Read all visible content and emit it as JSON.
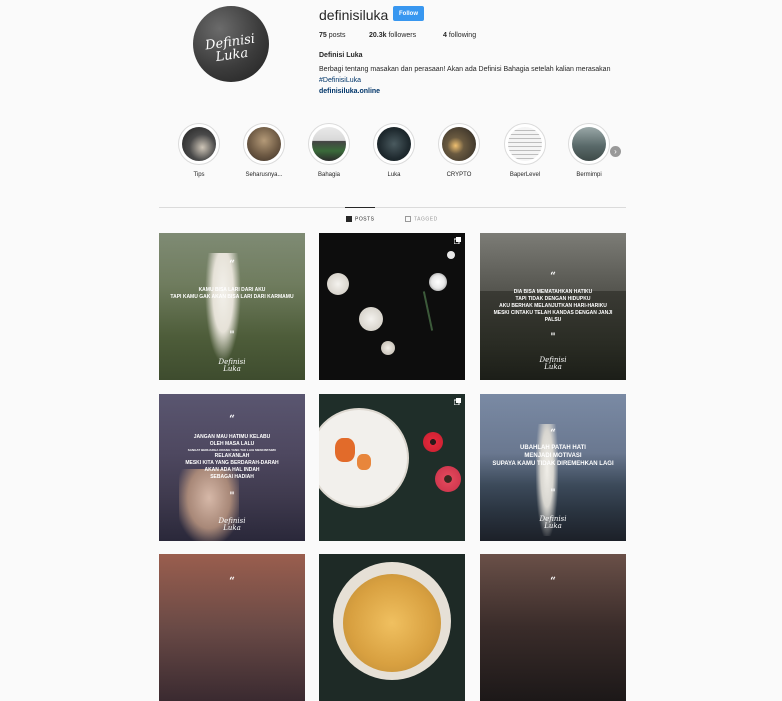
{
  "profile": {
    "username": "definisiluka",
    "follow_label": "Follow",
    "avatar_logo_line1": "Definisi",
    "avatar_logo_line2": "Luka",
    "posts_count": "75",
    "posts_label": "posts",
    "followers_count": "20.3k",
    "followers_label": "followers",
    "following_count": "4",
    "following_label": "following",
    "full_name": "Definisi Luka",
    "bio": "Berbagi tentang masakan dan perasaan! Akan ada Definisi Bahagia setelah kalian merasakan",
    "bio_hashtag": "#DefinisiLuka",
    "website": "definisiluka.online"
  },
  "highlights": [
    {
      "label": "Tips",
      "color": "#2a2a2a"
    },
    {
      "label": "Seharusnya...",
      "color": "#7a6a58"
    },
    {
      "label": "Bahagia",
      "color": "#b9b9b9"
    },
    {
      "label": "Luka",
      "color": "#1f2a2f"
    },
    {
      "label": "CRYPTO",
      "color": "#3a3530"
    },
    {
      "label": "BaperLevel",
      "color": "#e8e8e8"
    },
    {
      "label": "Bermimpi",
      "color": "#5a6a6a"
    }
  ],
  "tabs": {
    "posts": "POSTS",
    "tagged": "TAGGED"
  },
  "posts": [
    {
      "quote_mark": "“",
      "caption_line1": "KAMU BISA LARI DARI AKU",
      "caption_line2": "TAPI KAMU GAK AKAN BISA LARI DARI KARMAMU",
      "sig1": "Definisi",
      "sig2": "Luka"
    },
    {},
    {
      "quote_mark": "“",
      "caption_line1": "DIA BISA MEMATAHKAN HATIKU",
      "caption_line2": "TAPI TIDAK DENGAN HIDUPKU",
      "caption_line3": "AKU BERHAK MELANJUTKAN HARI-HARIKU",
      "caption_line4": "MESKI CINTAKU TELAH KANDAS DENGAN JANJI PALSU",
      "sig1": "Definisi",
      "sig2": "Luka"
    },
    {
      "quote_mark": "“",
      "caption_line1": "JANGAN MAU HATIMU KELABU",
      "caption_line2": "OLEH MASA LALU",
      "caption_line3": "SANGAT BERHARGA ORANG YANG TAK LAGI MENCINTAIMU",
      "caption_line4": "RELAKANLAH",
      "caption_line5": "MESKI KITA YANG BERDARAH-DARAH",
      "caption_line6": "AKAN ADA HAL INDAH",
      "caption_line7": "SEBAGAI HADIAH",
      "sig1": "Definisi",
      "sig2": "Luka"
    },
    {},
    {
      "quote_mark": "“",
      "caption_line1": "UBAHLAH PATAH HATI",
      "caption_line2": "MENJADI MOTIVASI",
      "caption_line3": "SUPAYA KAMU TIDAK DIREMEHKAN LAGI",
      "sig1": "Definisi",
      "sig2": "Luka"
    },
    {
      "quote_mark": "“"
    },
    {},
    {
      "quote_mark": "“"
    }
  ]
}
